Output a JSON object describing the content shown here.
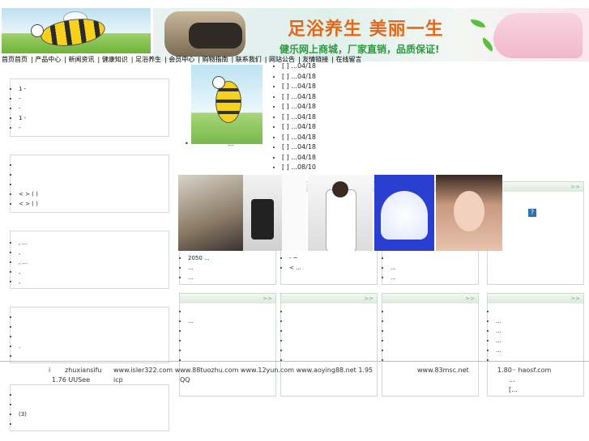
{
  "header": {
    "slogan": "足浴养生 美丽一生",
    "subslogan": "健乐网上商城，厂家直销，品质保证!",
    "nav": [
      "首页首页",
      "产品中心",
      "新闻资讯",
      "健康知识",
      "足浴养生",
      "会员中心",
      "购物指南",
      "联系我们",
      "网站公告",
      "友情链接",
      "在线留言"
    ]
  },
  "left_boxes": [
    {
      "items": [
        "1       -",
        "  -",
        "   -",
        "1         -",
        "   -"
      ]
    },
    {
      "items": [
        "",
        "",
        "",
        "     < > ( )",
        "     < > ( )",
        ""
      ]
    },
    {
      "items": [
        "          ,       ...",
        "     ,",
        "          ,       ...",
        "       ,",
        "       ,"
      ]
    },
    {
      "items": [
        "",
        "",
        "",
        "  .",
        ""
      ]
    },
    {
      "items": [
        "",
        "",
        "             (3)",
        ""
      ]
    }
  ],
  "news": [
    {
      "text": "[   ]         ...04/18"
    },
    {
      "text": "[   ]         ...04/18"
    },
    {
      "text": "[   ]         ...04/18"
    },
    {
      "text": "[   ]         ...04/18"
    },
    {
      "text": "[   ]         ...04/18"
    },
    {
      "text": "[   ]         ...04/18"
    },
    {
      "text": "[   ]         ...04/18"
    },
    {
      "text": "[   ]         ...04/18"
    },
    {
      "text": "[   ]         ...04/18"
    },
    {
      "text": "[   ]         ...04/18"
    },
    {
      "text": "[   ]         ...08/10"
    }
  ],
  "feature_caption": "...",
  "more": ">>",
  "col_boxes_row1": [
    {
      "items": [
        "",
        "",
        "   2050        ...",
        "      ...",
        "      ..."
      ]
    },
    {
      "items": [
        "- ~",
        "  <",
        "  <",
        "  <",
        "  < ..."
      ]
    },
    {
      "items": [
        "",
        "",
        "",
        "      ...",
        "      ..."
      ]
    },
    {
      "items": [
        "  • ",
        "       ...",
        "",
        "",
        "       ..."
      ]
    }
  ],
  "col_boxes_row2": [
    {
      "items": [
        "",
        "      ...",
        "",
        "",
        "",
        "",
        ""
      ]
    },
    {
      "items": [
        "",
        "",
        "",
        "",
        "",
        "",
        ""
      ]
    },
    {
      "items": [
        "",
        "",
        "",
        "",
        "",
        "",
        ""
      ]
    },
    {
      "items": [
        "",
        "       ...",
        "       ...",
        "       ...",
        "       ...",
        "       ...",
        "       ..."
      ]
    }
  ],
  "footer": {
    "line1": [
      "i",
      "zhuxiansifu",
      "www.isler322.com www.88tuozhu.com www.12yun.com www.aoying88.net 1.95",
      "www.83msc.net",
      "1.80··   haosf.com"
    ],
    "line2": [
      "1.76  UUSee",
      "icp",
      "QQ",
      "...",
      "[..."
    ]
  },
  "qmark": "?"
}
